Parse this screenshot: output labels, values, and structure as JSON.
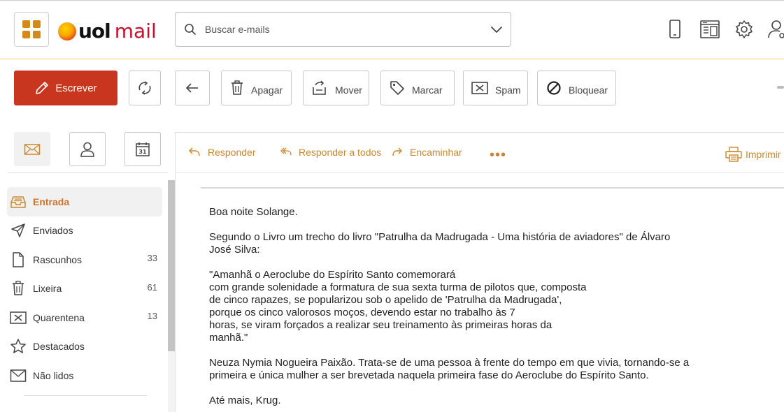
{
  "header": {
    "logo_uol": "uol",
    "logo_mail": "mail",
    "search_placeholder": "Buscar e-mails",
    "icons": [
      "apps-grid-icon",
      "search-icon",
      "chevron-down-icon",
      "mobile-icon",
      "layout-icon",
      "gear-icon",
      "user-settings-icon"
    ]
  },
  "toolbar": {
    "write": "Escrever",
    "delete": "Apagar",
    "move": "Mover",
    "tag": "Marcar",
    "spam": "Spam",
    "block": "Bloquear"
  },
  "sidebar": {
    "folders": [
      {
        "label": "Entrada",
        "count": "",
        "icon": "inbox-icon"
      },
      {
        "label": "Enviados",
        "count": "",
        "icon": "send-icon"
      },
      {
        "label": "Rascunhos",
        "count": "33",
        "icon": "draft-icon"
      },
      {
        "label": "Lixeira",
        "count": "61",
        "icon": "trash-icon"
      },
      {
        "label": "Quarentena",
        "count": "13",
        "icon": "quarantine-icon"
      },
      {
        "label": "Destacados",
        "count": "",
        "icon": "star-icon"
      },
      {
        "label": "Não lidos",
        "count": "",
        "icon": "envelope-icon"
      }
    ]
  },
  "message": {
    "actions": {
      "reply": "Responder",
      "reply_all": "Responder a todos",
      "forward": "Encaminhar",
      "more": "•••",
      "print": "Imprimir"
    },
    "paragraphs": [
      "Boa noite Solange.",
      "Segundo o Livro um trecho do livro \"Patrulha da Madrugada - Uma história de aviadores\" de Álvaro\nJosé Silva:",
      "\"Amanhã o Aeroclube do Espírito Santo comemorará\ncom grande solenidade a formatura de sua sexta turma de pilotos que, composta\nde cinco rapazes, se popularizou sob o apelido de 'Patrulha da Madrugada',\nporque os cinco valorosos moços, devendo estar no trabalho às 7\nhoras, se viram forçados a realizar seu treinamento às primeiras horas da\nmanhã.\"",
      "Neuza Nymia Nogueira Paixão. Trata-se de uma pessoa à frente do tempo em que vivia, tornando-se a\nprimeira e única mulher a ser brevetada naquela primeira fase do Aeroclube do Espírito Santo.",
      "Até mais, Krug."
    ]
  },
  "colors": {
    "accent": "#c9872a",
    "write_button": "#c9361f",
    "logo_mail": "#c8102e",
    "header_rule": "#e8d36a"
  }
}
